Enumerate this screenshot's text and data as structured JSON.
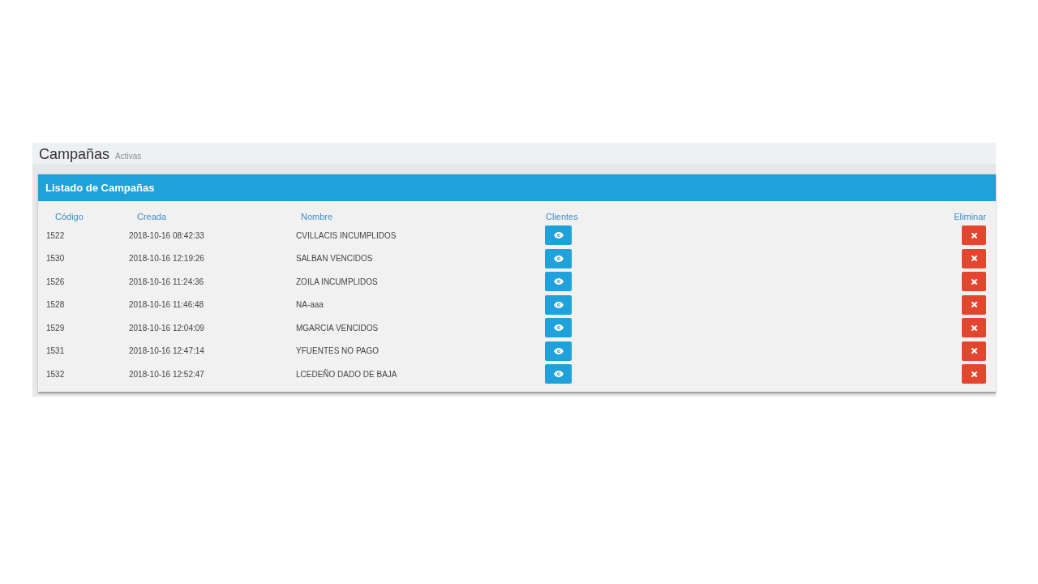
{
  "page_header": {
    "title": "Campañas",
    "subtitle": "Activas"
  },
  "panel": {
    "title": "Listado de Campañas",
    "table": {
      "columns": [
        "Código",
        "Creada",
        "Nombre",
        "Clientes",
        "Eliminar"
      ],
      "rows": [
        {
          "code": "1522",
          "created": "2018-10-16 08:42:33",
          "name": "CVILLACIS INCUMPLIDOS"
        },
        {
          "code": "1530",
          "created": "2018-10-16 12:19:26",
          "name": "SALBAN VENCIDOS"
        },
        {
          "code": "1526",
          "created": "2018-10-16 11:24:36",
          "name": "ZOILA INCUMPLIDOS"
        },
        {
          "code": "1528",
          "created": "2018-10-16 11:46:48",
          "name": "NA-aaa"
        },
        {
          "code": "1529",
          "created": "2018-10-16 12:04:09",
          "name": "MGARCIA VENCIDOS"
        },
        {
          "code": "1531",
          "created": "2018-10-16 12:47:14",
          "name": "YFUENTES NO PAGO"
        },
        {
          "code": "1532",
          "created": "2018-10-16 12:52:47",
          "name": "LCEDEÑO DADO DE BAJA"
        }
      ]
    }
  }
}
